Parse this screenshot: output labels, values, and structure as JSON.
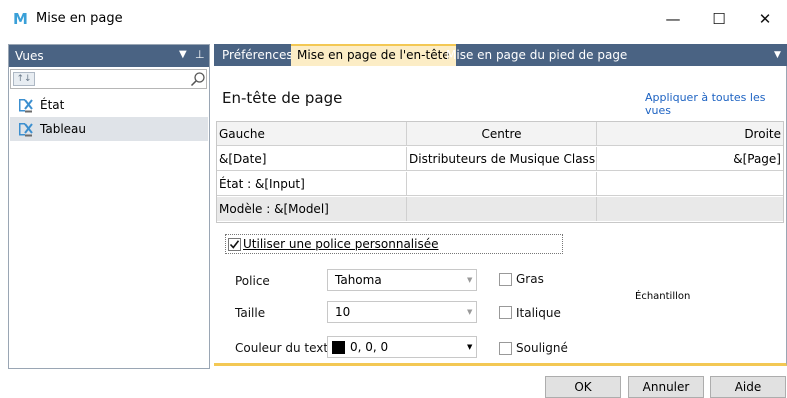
{
  "window": {
    "logo": "M",
    "title": "Mise en page",
    "minimize_label": "—",
    "maximize_label": "☐",
    "close_label": "✕"
  },
  "sidebar": {
    "title": "Vues",
    "search_placeholder": "",
    "items": [
      {
        "label": "État",
        "icon": "view-grid-icon",
        "selected": false
      },
      {
        "label": "Tableau",
        "icon": "view-grid-icon",
        "selected": true
      }
    ]
  },
  "tabs": [
    {
      "label": "Préférences",
      "active": false
    },
    {
      "label": "Mise en page de l'en-tête",
      "active": true
    },
    {
      "label": "Mise en page du pied de page",
      "active": false
    }
  ],
  "header_section": {
    "title": "En-tête de page",
    "apply_link": "Appliquer à toutes les vues"
  },
  "grid": {
    "columns": [
      "Gauche",
      "Centre",
      "Droite"
    ],
    "rows": [
      [
        "&[Date]",
        "Distributeurs de Musique Classique",
        "&[Page]"
      ],
      [
        "État : &[Input]",
        "",
        ""
      ],
      [
        "Modèle : &[Model]",
        "",
        ""
      ]
    ]
  },
  "font_options": {
    "use_custom_font_label": "Utiliser une police personnalisée",
    "use_custom_font_checked": true,
    "police_label": "Police",
    "police_value": "Tahoma",
    "taille_label": "Taille",
    "taille_value": "10",
    "couleur_label": "Couleur du texte",
    "couleur_value": "0, 0, 0",
    "couleur_swatch": "#000000",
    "gras_label": "Gras",
    "italique_label": "Italique",
    "souligne_label": "Souligné",
    "sample_label": "Échantillon"
  },
  "buttons": {
    "ok": "OK",
    "annuler": "Annuler",
    "aide": "Aide"
  },
  "colors": {
    "header_blue": "#4a6383",
    "active_tab_bg": "#fcedc6",
    "accent_yellow": "#f3c854",
    "link_blue": "#1c62c2"
  }
}
